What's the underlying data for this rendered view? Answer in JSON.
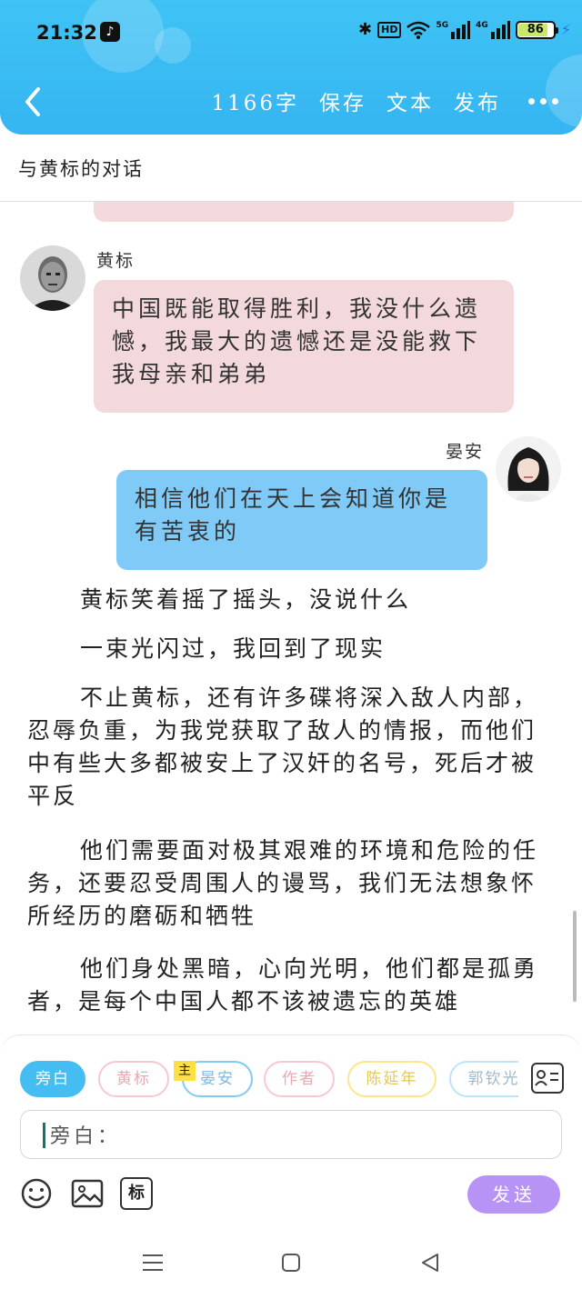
{
  "status": {
    "time": "21:32",
    "battery": "86",
    "battery_level": 0.86,
    "hd_label": "HD",
    "net_5g": "5G",
    "net_4g": "4G"
  },
  "toolbar": {
    "word_count": "1166字",
    "save": "保存",
    "text": "文本",
    "publish": "发布"
  },
  "title": "与黄标的对话",
  "messages": [
    {
      "sender": "黄标",
      "text": "中国既能取得胜利，我没什么遗憾，我最大的遗憾还是没能救下我母亲和弟弟"
    },
    {
      "sender": "晏安",
      "text": "相信他们在天上会知道你是有苦衷的"
    }
  ],
  "narration": [
    "黄标笑着摇了摇头，没说什么",
    "一束光闪过，我回到了现实",
    "不止黄标，还有许多碟将深入敌人内部，忍辱负重，为我党获取了敌人的情报，而他们中有些大多都被安上了汉奸的名号，死后才被平反",
    "他们需要面对极其艰难的环境和危险的任务，还要忍受周围人的谩骂，我们无法想象怀所经历的磨砺和牺牲",
    "他们身处黑暗，心向光明，他们都是孤勇者，是每个中国人都不该被遗忘的英雄"
  ],
  "roles": [
    {
      "label": "旁白",
      "color": "#45bdf2"
    },
    {
      "label": "黄标",
      "color": "#f6c9cf"
    },
    {
      "label": "晏安",
      "color": "#7fcaf6"
    },
    {
      "label": "作者",
      "color": "#f6c9cf"
    },
    {
      "label": "陈延年",
      "color": "#fde68a"
    },
    {
      "label": "郭钦光",
      "color": "#bfe3f7"
    }
  ],
  "main_tag": "主",
  "input": {
    "label": "旁白："
  },
  "send": "发送",
  "icons": {
    "back": "chevron-left-icon",
    "more": "more-dots-icon",
    "emoji": "smiley-icon",
    "image": "image-icon",
    "tag": "标",
    "contacts": "contact-card-icon"
  }
}
